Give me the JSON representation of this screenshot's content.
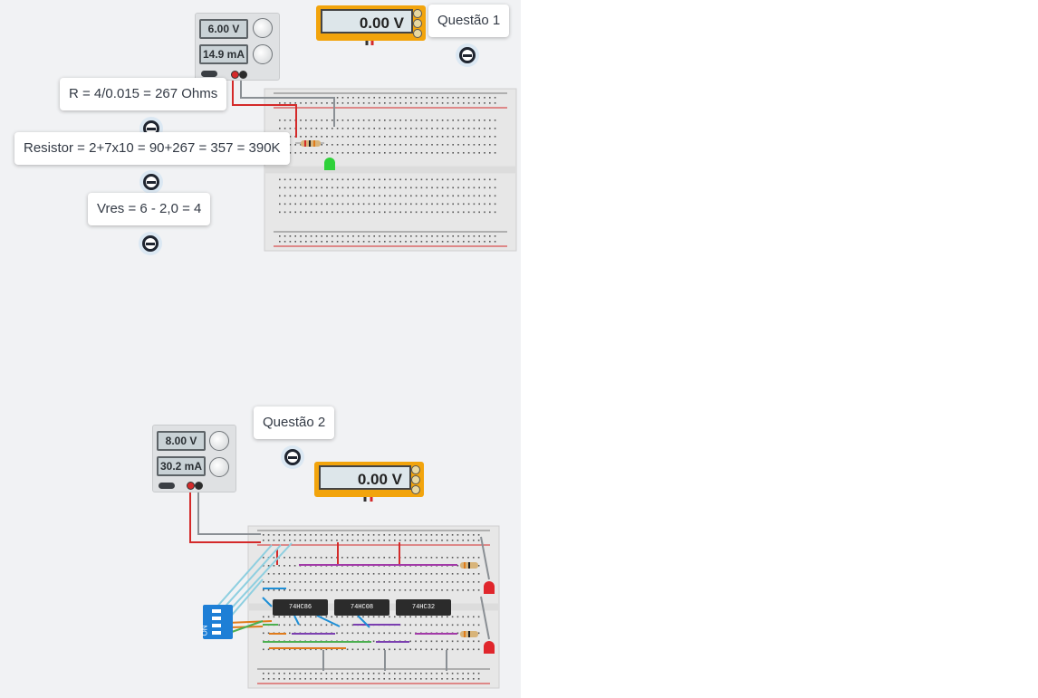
{
  "notes": {
    "questao1": "Questão 1",
    "questao2": "Questão 2",
    "r_formula": "R = 4/0.015 = 267 Ohms",
    "resistor_formula": "Resistor = 2+7x10 = 90+267 = 357 = 390K",
    "vres_formula": "Vres = 6 - 2,0 = 4"
  },
  "circuit1": {
    "psu_voltage": "6.00 V",
    "psu_current": "14.9 mA",
    "meter_reading": "0.00 V"
  },
  "circuit2": {
    "psu_voltage": "8.00 V",
    "psu_current": "30.2 mA",
    "meter_reading": "0.00 V",
    "chips": [
      "74HC86",
      "74HC08",
      "74HC32"
    ],
    "dip_label": "ON"
  },
  "icons": {
    "note": "note-collapse-icon",
    "knob": "knob-icon"
  },
  "colors": {
    "canvas": "#f1f2f4",
    "meter": "#f2a40c",
    "wire_red": "#d42a2a",
    "wire_gray": "#8a8f94",
    "led_green": "#2fd13a",
    "led_red": "#e0262c",
    "dip_switch": "#1e7fd6"
  }
}
